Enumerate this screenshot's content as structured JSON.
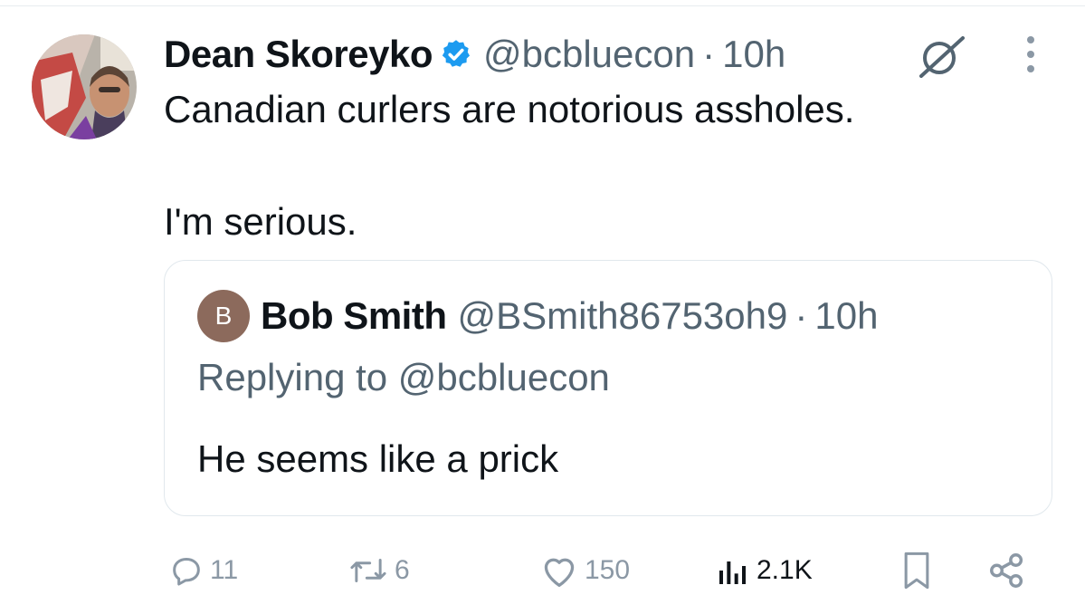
{
  "tweet": {
    "display_name": "Dean Skoreyko",
    "handle": "@bcbluecon",
    "separator": "·",
    "time": "10h",
    "text": "Canadian curlers are notorious assholes.\n\nI'm serious.",
    "verified": true,
    "icons": [
      "verified-badge-icon",
      "grok-icon",
      "more-options-icon"
    ]
  },
  "quote": {
    "avatar_letter": "B",
    "display_name": "Bob Smith",
    "handle": "@BSmith86753oh9",
    "separator": "·",
    "time": "10h",
    "replying_to": "Replying to @bcbluecon",
    "text": "He seems like a prick"
  },
  "actions": {
    "replies": "11",
    "reposts": "6",
    "likes": "150",
    "views": "2.1K",
    "icons": [
      "reply-icon",
      "repost-icon",
      "like-icon",
      "views-icon",
      "bookmark-icon",
      "share-icon"
    ]
  },
  "colors": {
    "text_primary": "#0f1419",
    "text_secondary": "#536471",
    "action_gray": "#8b98a5",
    "verified_blue": "#1d9bf0",
    "card_border": "#e1e8ed"
  }
}
